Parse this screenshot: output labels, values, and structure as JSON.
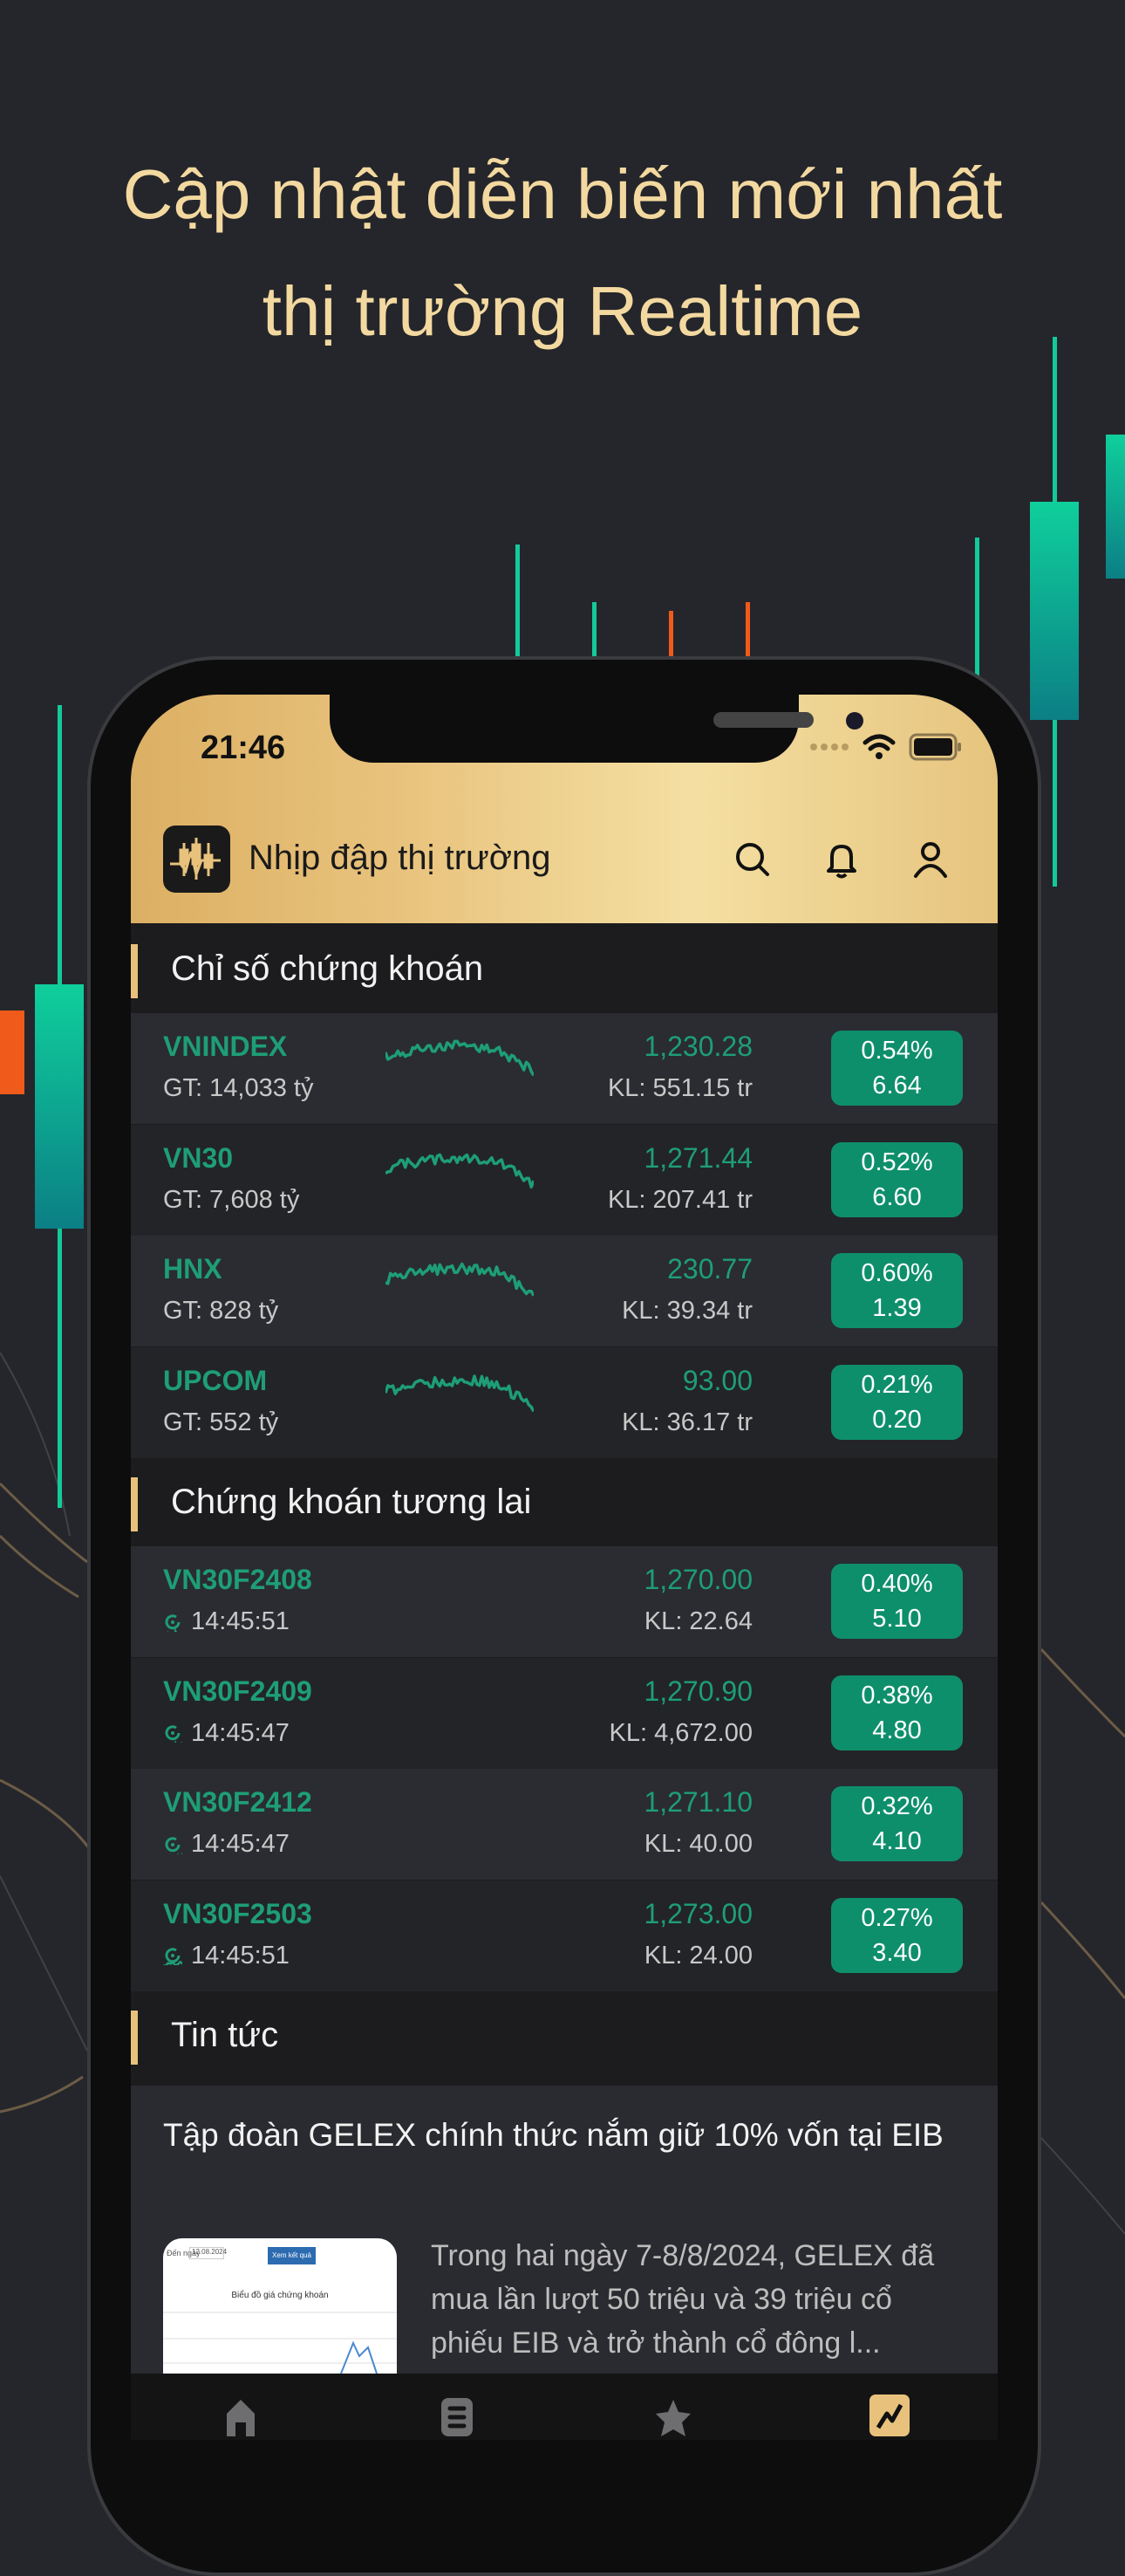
{
  "headline": {
    "line1": "Cập nhật diễn biến mới nhất",
    "line2": "thị trường Realtime"
  },
  "status_bar": {
    "time": "21:46"
  },
  "header": {
    "title": "Nhịp đập thị trường",
    "icons": [
      "search-icon",
      "bell-icon",
      "user-icon"
    ]
  },
  "colors": {
    "gold": "#e8c27c",
    "up_green": "#1e9e75",
    "badge_green": "#0e8f6c",
    "background": "#25262b"
  },
  "indices": {
    "title": "Chỉ số chứng khoán",
    "rows": [
      {
        "name": "VNINDEX",
        "sub": "GT: 14,033 tỷ",
        "price": "1,230.28",
        "volume": "KL: 551.15 tr",
        "pct": "0.54%",
        "change": "6.64"
      },
      {
        "name": "VN30",
        "sub": "GT: 7,608 tỷ",
        "price": "1,271.44",
        "volume": "KL: 207.41 tr",
        "pct": "0.52%",
        "change": "6.60"
      },
      {
        "name": "HNX",
        "sub": "GT: 828 tỷ",
        "price": "230.77",
        "volume": "KL: 39.34 tr",
        "pct": "0.60%",
        "change": "1.39"
      },
      {
        "name": "UPCOM",
        "sub": "GT: 552 tỷ",
        "price": "93.00",
        "volume": "KL: 36.17 tr",
        "pct": "0.21%",
        "change": "0.20"
      }
    ]
  },
  "futures": {
    "title": "Chứng khoán tương lai",
    "rows": [
      {
        "name": "VN30F2408",
        "time": "14:45:51",
        "price": "1,270.00",
        "volume": "KL: 22.64",
        "pct": "0.40%",
        "change": "5.10"
      },
      {
        "name": "VN30F2409",
        "time": "14:45:47",
        "price": "1,270.90",
        "volume": "KL: 4,672.00",
        "pct": "0.38%",
        "change": "4.80"
      },
      {
        "name": "VN30F2412",
        "time": "14:45:47",
        "price": "1,271.10",
        "volume": "KL: 40.00",
        "pct": "0.32%",
        "change": "4.10"
      },
      {
        "name": "VN30F2503",
        "time": "14:45:51",
        "price": "1,273.00",
        "volume": "KL: 24.00",
        "pct": "0.27%",
        "change": "3.40"
      }
    ]
  },
  "news": {
    "title": "Tin tức",
    "item": {
      "headline": "Tập đoàn GELEX chính thức nắm giữ 10% vốn tại EIB",
      "summary": "Trong hai ngày 7-8/8/2024, GELEX đã mua lần lượt 50 triệu và 39 triệu cổ phiếu EIB và trở thành cổ đông l...",
      "thumb": {
        "date": "12.08.2024",
        "button": "Xem kết quả",
        "caption": "Biểu đồ giá chứng khoán",
        "label": "Đến ngày"
      }
    }
  },
  "tabbar": {
    "items": [
      "home-icon",
      "list-icon",
      "star-icon",
      "chart-icon"
    ],
    "active": 3
  }
}
